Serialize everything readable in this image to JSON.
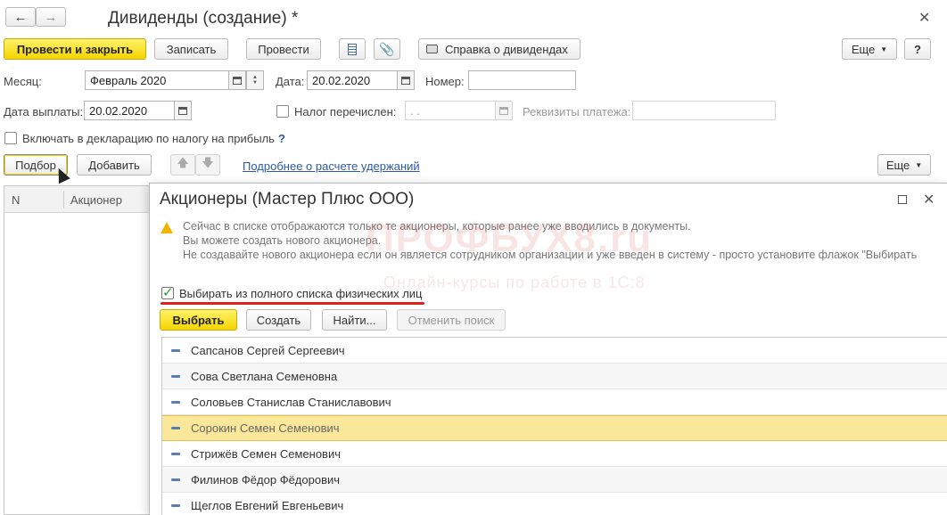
{
  "window": {
    "title": "Дивиденды (создание) *"
  },
  "toolbar": {
    "post_close": "Провести и закрыть",
    "save": "Записать",
    "post": "Провести",
    "report": "Справка о дивидендах",
    "more": "Еще",
    "help": "?"
  },
  "form": {
    "month_label": "Месяц:",
    "month_value": "Февраль 2020",
    "date_label": "Дата:",
    "date_value": "20.02.2020",
    "number_label": "Номер:",
    "number_value": "",
    "pay_date_label": "Дата выплаты:",
    "pay_date_value": "20.02.2020",
    "tax_paid_label": "Налог перечислен:",
    "tax_paid_date": " .  .",
    "payment_details_label": "Реквизиты платежа:",
    "payment_details_value": "",
    "include_decl_label": "Включать в декларацию по налогу на прибыль",
    "help_q": "?"
  },
  "table_toolbar": {
    "select": "Подбор",
    "add": "Добавить",
    "details_link": "Подробнее о расчете удержаний",
    "more": "Еще"
  },
  "table": {
    "col_n": "N",
    "col_shareholder": "Акционер"
  },
  "dialog": {
    "title": "Акционеры (Мастер Плюс ООО)",
    "warning_lines": [
      "Сейчас в списке отображаются только те акционеры, которые ранее уже вводились в документы.",
      "Вы можете создать нового акционера.",
      "Не создавайте нового акционера если он является сотрудником организации и уже введен в систему - просто установите флажок \"Выбирать"
    ],
    "full_list_label": "Выбирать из полного списка физических лиц",
    "buttons": {
      "choose": "Выбрать",
      "create": "Создать",
      "find": "Найти...",
      "cancel_search": "Отменить поиск"
    },
    "rows": [
      "Сапсанов Сергей Сергеевич",
      "Сова Светлана Семеновна",
      "Соловьев Станислав Станиславович",
      "Сорокин Семен Семенович",
      "Стрижёв Семен Семенович",
      "Филинов Фёдор Фёдорович",
      "Щеглов Евгений Евгеньевич"
    ]
  },
  "watermark": {
    "brand": "ПРОФБУХ8.ru",
    "tagline": "Онлайн-курсы по работе в 1С:8"
  },
  "colors": {
    "accent_yellow": "#f5d400",
    "selected_row": "#fbe79a",
    "underline_red": "#e0201c",
    "check_green": "#2e9a2e"
  }
}
